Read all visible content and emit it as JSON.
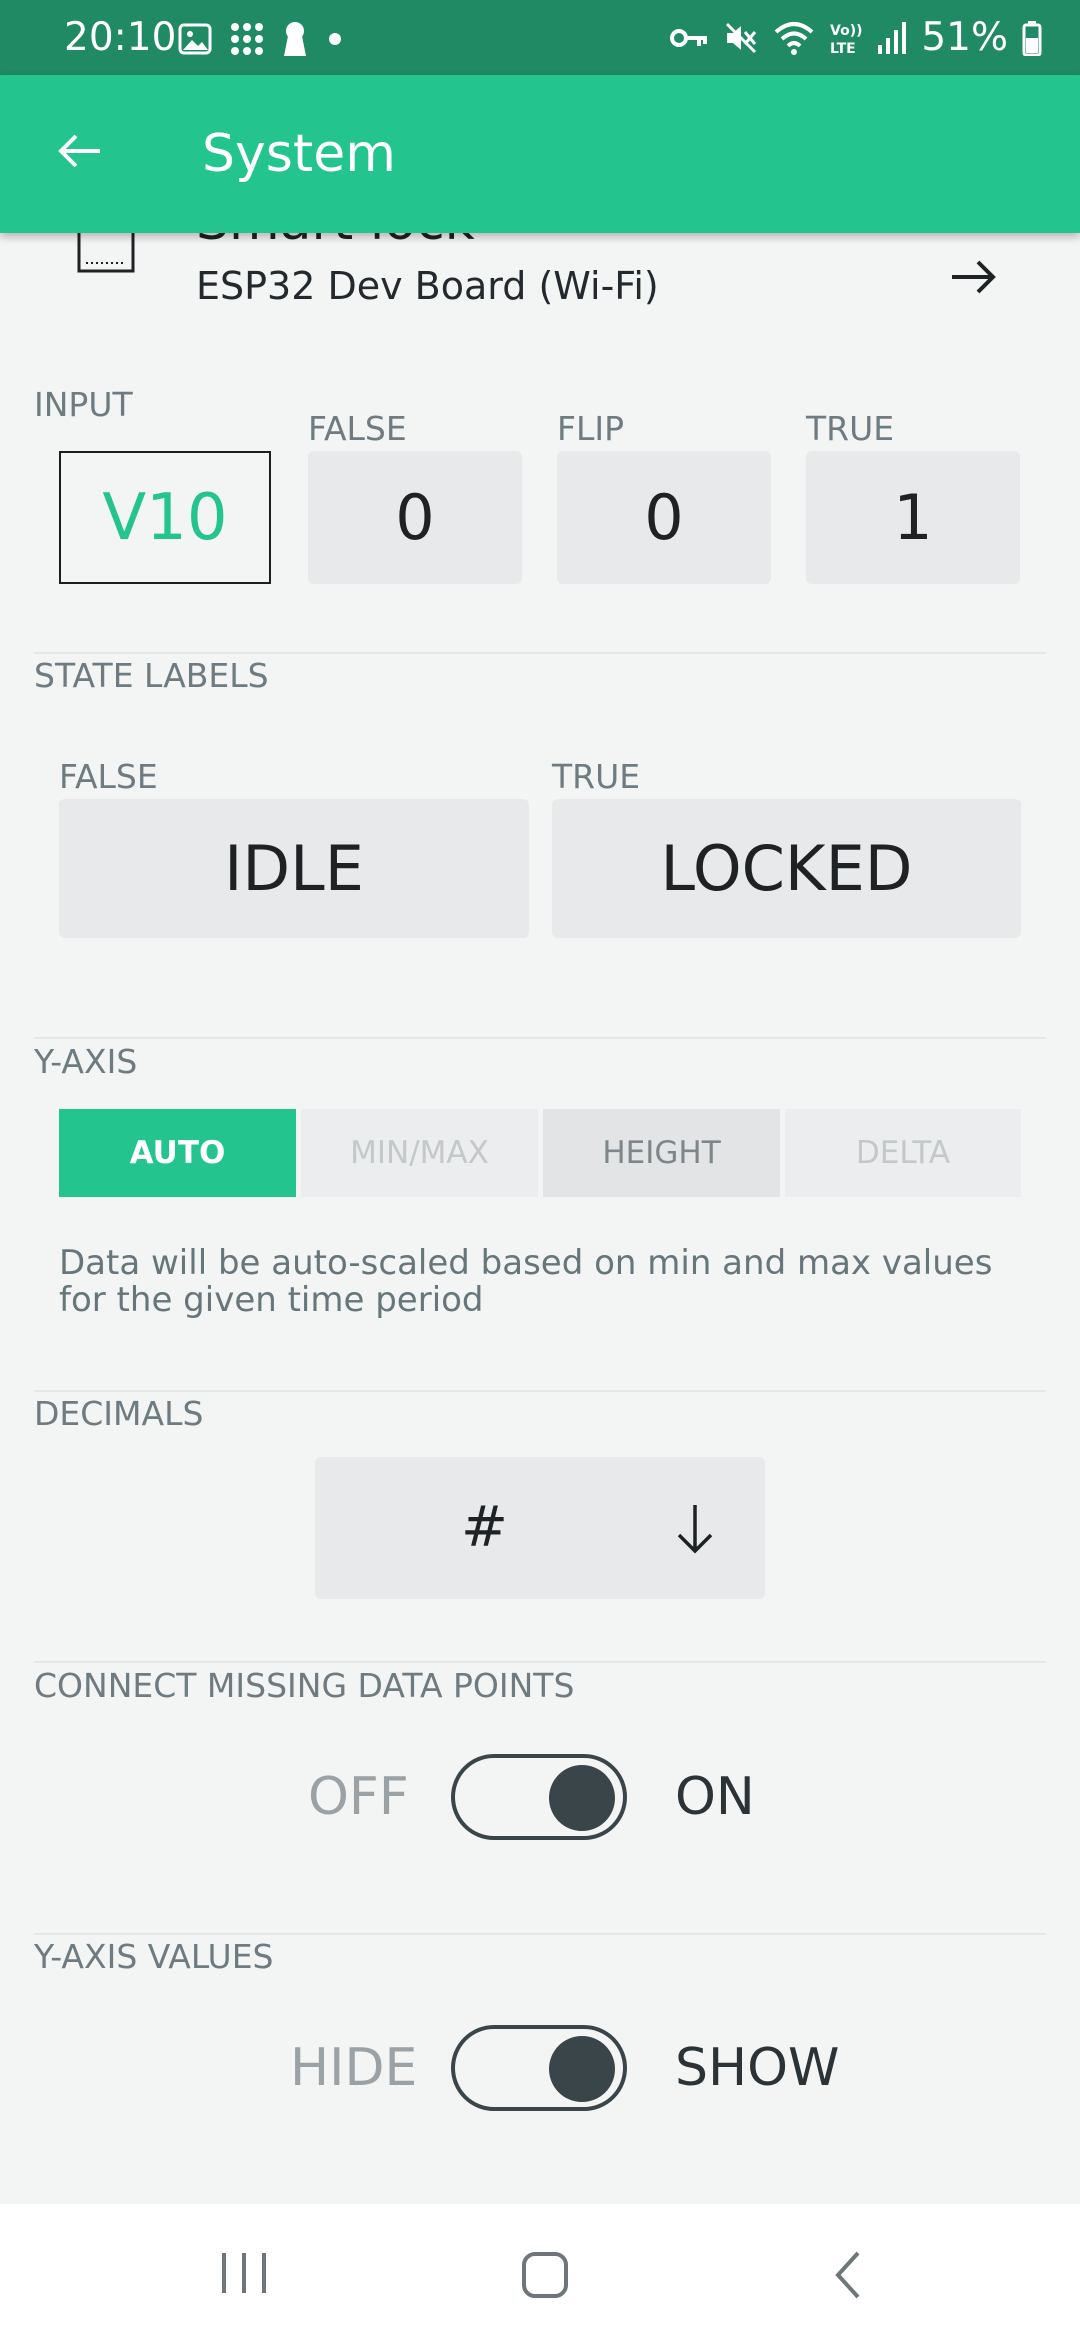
{
  "status_bar": {
    "time": "20:10",
    "battery": "51%"
  },
  "app_bar": {
    "title": "System"
  },
  "device": {
    "name": "Smart lock",
    "board": "ESP32 Dev Board (Wi-Fi)"
  },
  "input_section": {
    "label": "INPUT",
    "pin": "V10",
    "false_label": "FALSE",
    "false_value": "0",
    "flip_label": "FLIP",
    "flip_value": "0",
    "true_label": "TRUE",
    "true_value": "1"
  },
  "state_labels": {
    "label": "STATE LABELS",
    "false_label": "FALSE",
    "false_value": "IDLE",
    "true_label": "TRUE",
    "true_value": "LOCKED"
  },
  "y_axis": {
    "label": "Y-AXIS",
    "options": [
      "AUTO",
      "MIN/MAX",
      "HEIGHT",
      "DELTA"
    ],
    "selected": "AUTO",
    "help": "Data will be auto-scaled based on min and max values for the given time period"
  },
  "decimals": {
    "label": "DECIMALS",
    "value": "#"
  },
  "connect_missing": {
    "label": "CONNECT MISSING DATA POINTS",
    "off_text": "OFF",
    "on_text": "ON",
    "state": true
  },
  "y_axis_values": {
    "label": "Y-AXIS VALUES",
    "off_text": "HIDE",
    "on_text": "SHOW",
    "state": true
  },
  "colors": {
    "accent": "#23c48e",
    "status_bar": "#1f8a63",
    "toggle": "#3a4549"
  }
}
